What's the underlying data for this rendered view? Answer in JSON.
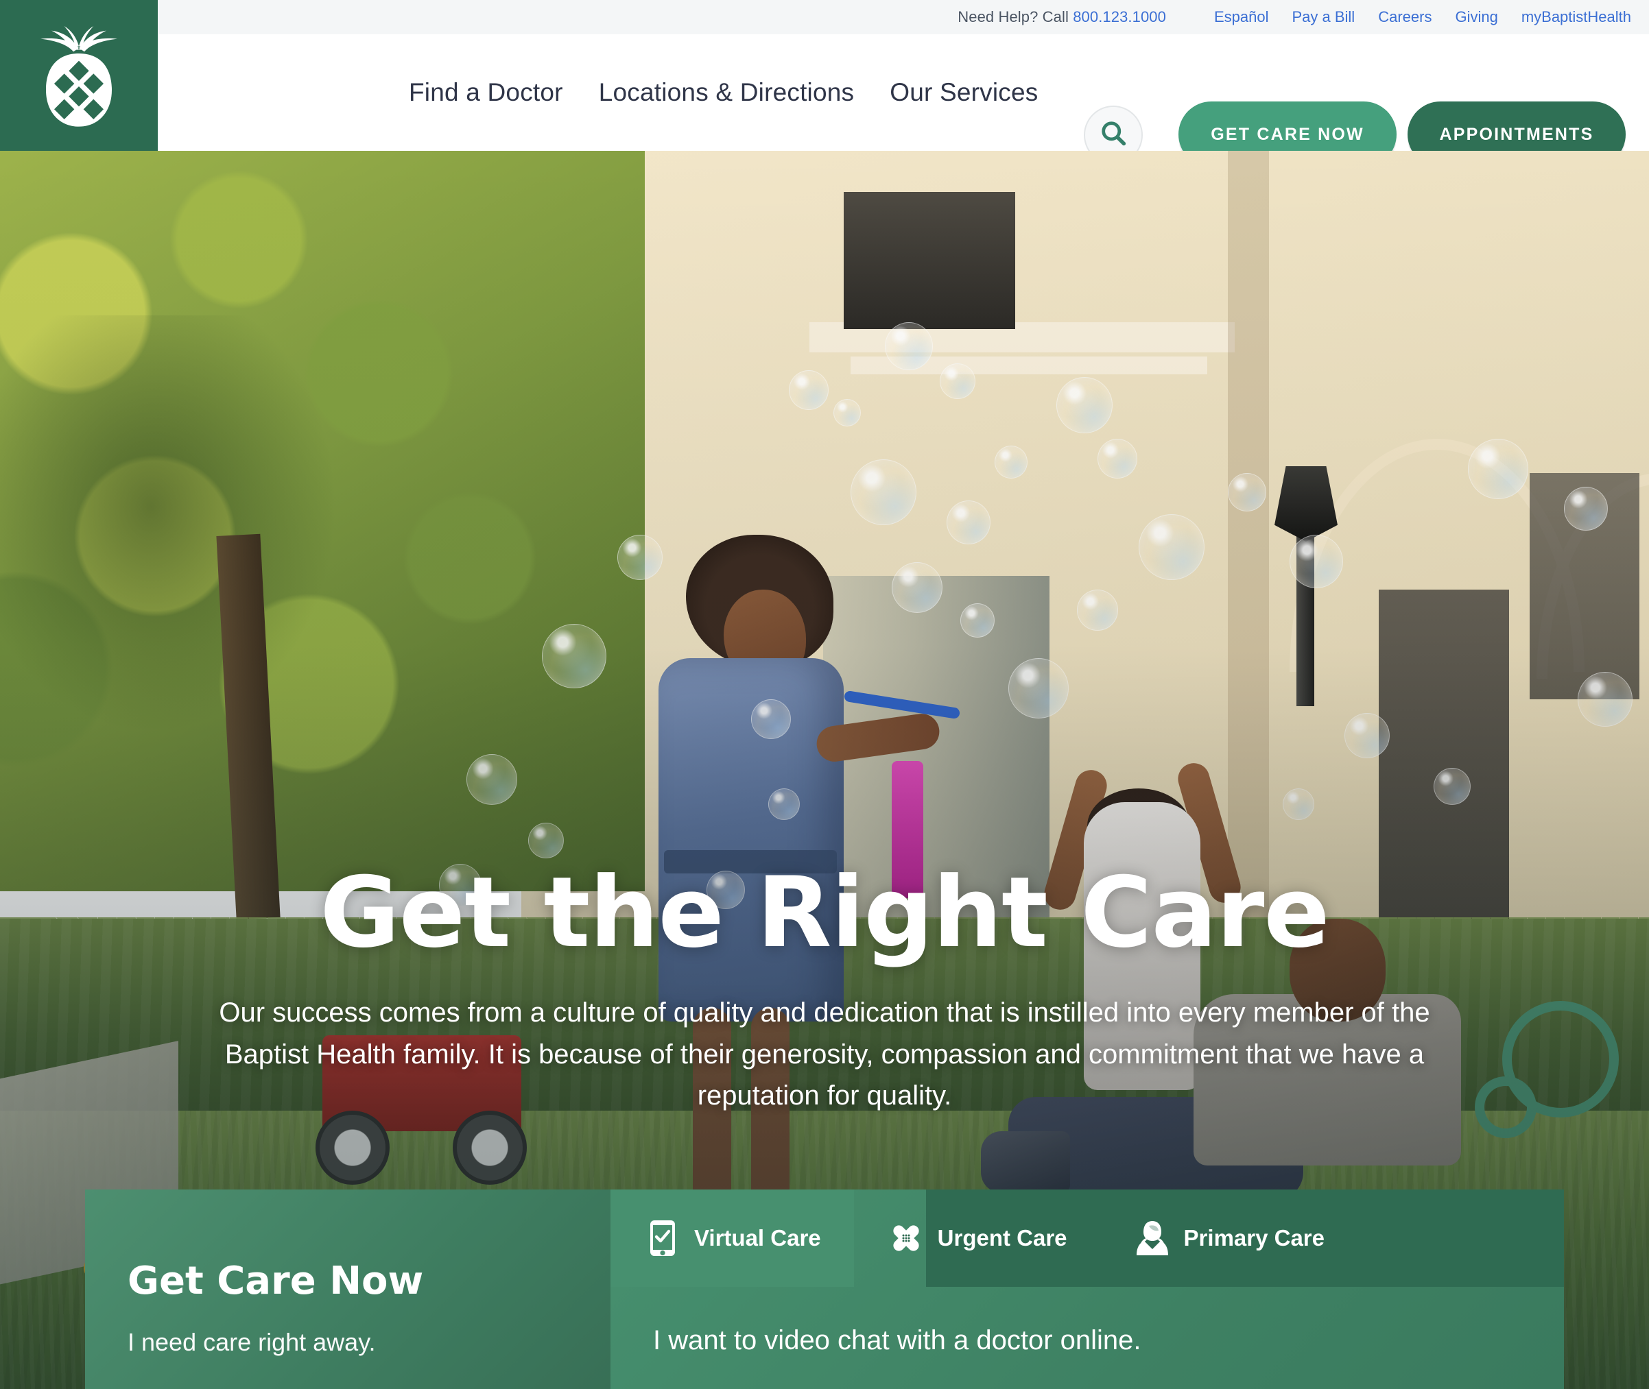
{
  "brand": {
    "logo_icon": "pineapple-logo",
    "green_dark": "#2c6b51",
    "green_mid": "#2f7055",
    "green_light": "#45a07d",
    "link_blue": "#3b6fd4"
  },
  "utility_bar": {
    "help_prefix": "Need Help? Call",
    "phone": "800.123.1000",
    "links": [
      {
        "label": "Español"
      },
      {
        "label": "Pay a Bill"
      },
      {
        "label": "Careers"
      },
      {
        "label": "Giving"
      },
      {
        "label": "myBaptistHealth"
      }
    ]
  },
  "header": {
    "nav": [
      {
        "label": "Find a Doctor"
      },
      {
        "label": "Locations & Directions"
      },
      {
        "label": "Our Services"
      }
    ],
    "search_icon": "search-icon",
    "buttons": [
      {
        "label": "GET CARE NOW",
        "style": "light"
      },
      {
        "label": "APPOINTMENTS",
        "style": "dark"
      }
    ]
  },
  "hero": {
    "title": "Get the Right Care",
    "subtitle": "Our success comes from a culture of quality and dedication that is instilled into every member of the Baptist Health family. It is because of their generosity, compassion and commitment that we have a reputation for quality."
  },
  "care_panel": {
    "heading": "Get Care Now",
    "subheading": "I need care right away.",
    "tabs": [
      {
        "label": "Virtual Care",
        "icon": "mobile-phone-check-icon",
        "active": true
      },
      {
        "label": "Urgent Care",
        "icon": "crossed-bandages-icon",
        "active": false
      },
      {
        "label": "Primary Care",
        "icon": "doctor-stethoscope-icon",
        "active": false
      }
    ],
    "active_tab_description": "I want to video chat with a doctor online."
  }
}
